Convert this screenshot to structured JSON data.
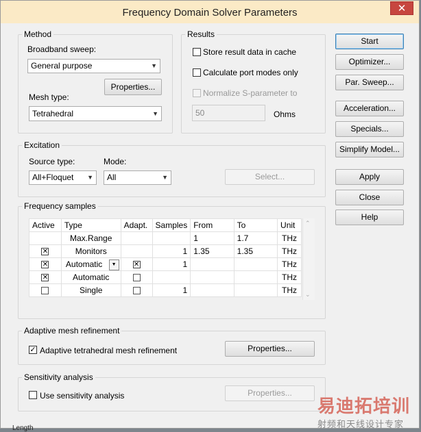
{
  "window": {
    "title": "Frequency Domain Solver Parameters",
    "close_glyph": "✕"
  },
  "method": {
    "group_label": "Method",
    "broadband_label": "Broadband sweep:",
    "broadband_value": "General purpose",
    "properties_label": "Properties...",
    "mesh_type_label": "Mesh type:",
    "mesh_type_value": "Tetrahedral"
  },
  "results": {
    "group_label": "Results",
    "store_cache_label": "Store result data in cache",
    "store_cache_checked": false,
    "port_modes_label": "Calculate port modes only",
    "port_modes_checked": false,
    "normalize_label": "Normalize S-parameter to",
    "normalize_checked": false,
    "normalize_value": "50",
    "ohms_label": "Ohms"
  },
  "side_buttons": {
    "start": "Start",
    "optimizer": "Optimizer...",
    "par_sweep": "Par. Sweep...",
    "acceleration": "Acceleration...",
    "specials": "Specials...",
    "simplify_model": "Simplify Model...",
    "apply": "Apply",
    "close": "Close",
    "help": "Help"
  },
  "excitation": {
    "group_label": "Excitation",
    "source_type_label": "Source type:",
    "source_type_value": "All+Floquet",
    "mode_label": "Mode:",
    "mode_value": "All",
    "select_label": "Select..."
  },
  "frequency_samples": {
    "group_label": "Frequency samples",
    "columns": [
      "Active",
      "Type",
      "Adapt.",
      "Samples",
      "From",
      "To",
      "Unit"
    ],
    "rows": [
      {
        "active": null,
        "type": "Max.Range",
        "adapt": null,
        "samples": "",
        "from": "1",
        "to": "1.7",
        "unit": "THz"
      },
      {
        "active": true,
        "type": "Monitors",
        "adapt": null,
        "samples": "1",
        "from": "1.35",
        "to": "1.35",
        "unit": "THz"
      },
      {
        "active": true,
        "type": "Automatic",
        "adapt": true,
        "samples": "1",
        "from": "",
        "to": "",
        "unit": "THz",
        "dropdown": true
      },
      {
        "active": true,
        "type": "Automatic",
        "adapt": false,
        "samples": "",
        "from": "",
        "to": "",
        "unit": "THz"
      },
      {
        "active": false,
        "type": "Single",
        "adapt": false,
        "samples": "1",
        "from": "",
        "to": "",
        "unit": "THz"
      }
    ]
  },
  "adaptive": {
    "group_label": "Adaptive mesh refinement",
    "checkbox_label": "Adaptive tetrahedral mesh refinement",
    "checked": true,
    "properties_label": "Properties..."
  },
  "sensitivity": {
    "group_label": "Sensitivity analysis",
    "checkbox_label": "Use sensitivity analysis",
    "checked": false,
    "properties_label": "Properties..."
  },
  "watermark": {
    "line1": "易迪拓培训",
    "line2": "射频和天线设计专家"
  },
  "background_text": "Length"
}
